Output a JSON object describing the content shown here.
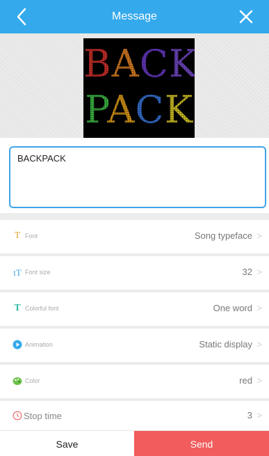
{
  "header": {
    "title": "Message"
  },
  "preview": {
    "line1": [
      {
        "ch": "B",
        "color": "#e1342f"
      },
      {
        "ch": "A",
        "color": "#f08a24"
      },
      {
        "ch": "C",
        "color": "#6f3dd6"
      },
      {
        "ch": "K",
        "color": "#7b4ed9"
      }
    ],
    "line2": [
      {
        "ch": "P",
        "color": "#43c94a"
      },
      {
        "ch": "A",
        "color": "#f0a818"
      },
      {
        "ch": "C",
        "color": "#3a7de8"
      },
      {
        "ch": "K",
        "color": "#e6d62a"
      }
    ]
  },
  "message": {
    "text": "BACKPACK"
  },
  "settings": [
    {
      "label": "Font",
      "value": "Song typeface",
      "icon": "font-icon"
    },
    {
      "label": "Font size",
      "value": "32",
      "icon": "font-size-icon"
    },
    {
      "label": "Colorful font",
      "value": "One word",
      "icon": "colorful-font-icon"
    },
    {
      "label": "Animation",
      "value": "Static display",
      "icon": "animation-icon"
    },
    {
      "label": "Color",
      "value": "red",
      "icon": "color-palette-icon"
    },
    {
      "label": "Stop time",
      "value": "3",
      "icon": "clock-icon"
    }
  ],
  "buttons": {
    "save": "Save",
    "send": "Send"
  },
  "colors": {
    "header": "#34a9ec",
    "send": "#f25c5c",
    "input_border": "#3fa4e8"
  }
}
